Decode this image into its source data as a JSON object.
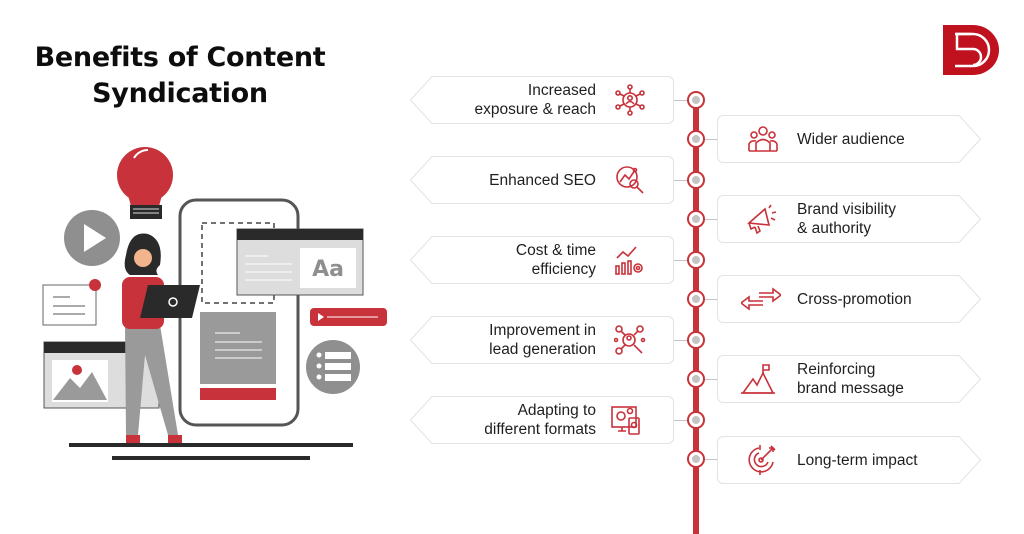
{
  "title": {
    "line1": "Benefits of Content",
    "line2": "Syndication"
  },
  "brand": {
    "logo_icon": "ds-logo-icon",
    "accent_color": "#c8323a",
    "logo_color": "#c0111f"
  },
  "illustration": {
    "description": "woman-with-laptop-content-illustration",
    "type_sample": "Aa"
  },
  "benefits_left": [
    {
      "line1": "Increased",
      "line2": "exposure & reach",
      "icon": "network-user-icon"
    },
    {
      "line1": "Enhanced SEO",
      "line2": "",
      "icon": "seo-magnifier-icon"
    },
    {
      "line1": "Cost & time",
      "line2": "efficiency",
      "icon": "chart-gear-icon"
    },
    {
      "line1": "Improvement in",
      "line2": "lead generation",
      "icon": "lead-search-icon"
    },
    {
      "line1": "Adapting to",
      "line2": "different formats",
      "icon": "devices-gear-icon"
    }
  ],
  "benefits_right": [
    {
      "line1": "Wider audience",
      "line2": "",
      "icon": "audience-icon"
    },
    {
      "line1": "Brand visibility",
      "line2": "& authority",
      "icon": "megaphone-icon"
    },
    {
      "line1": "Cross-promotion",
      "line2": "",
      "icon": "exchange-arrows-icon"
    },
    {
      "line1": "Reinforcing",
      "line2": "brand message",
      "icon": "mountain-flag-icon"
    },
    {
      "line1": "Long-term impact",
      "line2": "",
      "icon": "target-arrow-icon"
    }
  ]
}
